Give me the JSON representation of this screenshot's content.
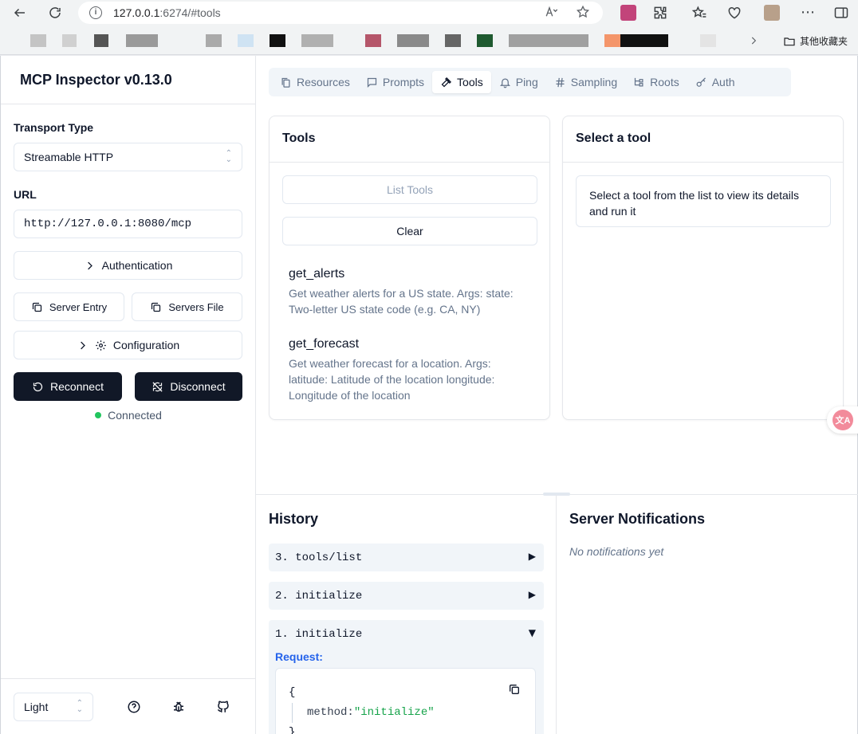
{
  "browser": {
    "url_host": "127.0.0.1",
    "url_path": ":6274/#tools",
    "bookmarks_folder": "其他收藏夹"
  },
  "sidebar": {
    "title": "MCP Inspector v0.13.0",
    "transport_label": "Transport Type",
    "transport_value": "Streamable HTTP",
    "url_label": "URL",
    "url_value": "http://127.0.0.1:8080/mcp",
    "authentication": "Authentication",
    "server_entry": "Server Entry",
    "servers_file": "Servers File",
    "configuration": "Configuration",
    "reconnect": "Reconnect",
    "disconnect": "Disconnect",
    "status": "Connected",
    "theme_value": "Light"
  },
  "tabs": [
    {
      "label": "Resources",
      "icon": "files-icon"
    },
    {
      "label": "Prompts",
      "icon": "message-icon"
    },
    {
      "label": "Tools",
      "icon": "hammer-icon"
    },
    {
      "label": "Ping",
      "icon": "bell-icon"
    },
    {
      "label": "Sampling",
      "icon": "hash-icon"
    },
    {
      "label": "Roots",
      "icon": "folder-tree-icon"
    },
    {
      "label": "Auth",
      "icon": "key-icon"
    }
  ],
  "active_tab": "Tools",
  "tools_panel": {
    "title": "Tools",
    "list_button": "List Tools",
    "clear_button": "Clear",
    "tools": [
      {
        "name": "get_alerts",
        "description": "Get weather alerts for a US state. Args: state: Two-letter US state code (e.g. CA, NY)"
      },
      {
        "name": "get_forecast",
        "description": "Get weather forecast for a location. Args: latitude: Latitude of the location longitude: Longitude of the location"
      }
    ]
  },
  "detail_panel": {
    "title": "Select a tool",
    "hint": "Select a tool from the list to view its details and run it"
  },
  "history": {
    "title": "History",
    "items": [
      {
        "label": "3. tools/list",
        "arrow": "▶"
      },
      {
        "label": "2. initialize",
        "arrow": "▶"
      },
      {
        "label": "1. initialize",
        "arrow": "▼"
      }
    ],
    "request_label": "Request:",
    "code_open": "{",
    "code_key": "method:",
    "code_value": "\"initialize\"",
    "code_close": "}"
  },
  "notifications": {
    "title": "Server Notifications",
    "empty": "No notifications yet"
  },
  "colors": {
    "accent_dark": "#111827",
    "connected": "#22c55e",
    "request_label": "#2563eb",
    "json_string": "#16a34a"
  }
}
